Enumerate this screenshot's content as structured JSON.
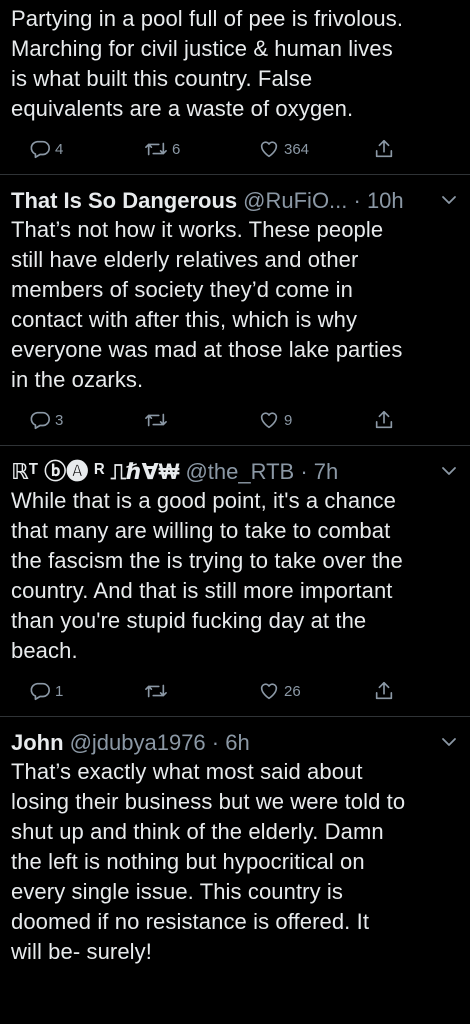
{
  "colors": {
    "background": "#000000",
    "text": "#e8ebed",
    "muted": "#8b98a5",
    "divider": "#2f3336"
  },
  "tweets": [
    {
      "author": "",
      "meta": "",
      "lines": [
        "Partying in a pool full of pee is frivolous.",
        "Marching for civil justice & human lives",
        "is what built this country. False",
        "equivalents are a waste of oxygen."
      ],
      "reply_count": "4",
      "retweet_count": "6",
      "like_count": "364"
    },
    {
      "author": "That Is So Dangerous",
      "meta": "@RuFiO... · 10h",
      "lines": [
        "That’s not how it works. These people",
        "still have elderly relatives and other",
        "members of society they’d come in",
        "contact with after this, which is why",
        "everyone was mad at those lake parties",
        "in the ozarks."
      ],
      "reply_count": "3",
      "retweet_count": "",
      "like_count": "9"
    },
    {
      "author": "ℝᵀ ⓑ🅐 ᴿ ⎍ℏ∀₩",
      "meta": "@the_RTB · 7h",
      "lines": [
        "While that is a good point, it's a chance",
        "that many are willing to take to combat",
        "the fascism the is trying to take over the",
        "country. And that is still more important",
        "than you're stupid fucking day at the",
        "beach."
      ],
      "reply_count": "1",
      "retweet_count": "",
      "like_count": "26"
    },
    {
      "author": "John",
      "meta": "@jdubya1976 · 6h",
      "lines": [
        "That’s exactly what most said about",
        "losing their business but we were told to",
        "shut up and think of the elderly.  Damn",
        "the left is nothing but hypocritical on",
        "every single issue.  This country is",
        "doomed if no resistance is offered.  It",
        "will be- surely!"
      ],
      "reply_count": "",
      "retweet_count": "",
      "like_count": ""
    }
  ],
  "icons": {
    "reply": "reply-icon",
    "retweet": "retweet-icon",
    "like": "heart-icon",
    "share": "share-icon",
    "more": "chevron-down-icon"
  }
}
